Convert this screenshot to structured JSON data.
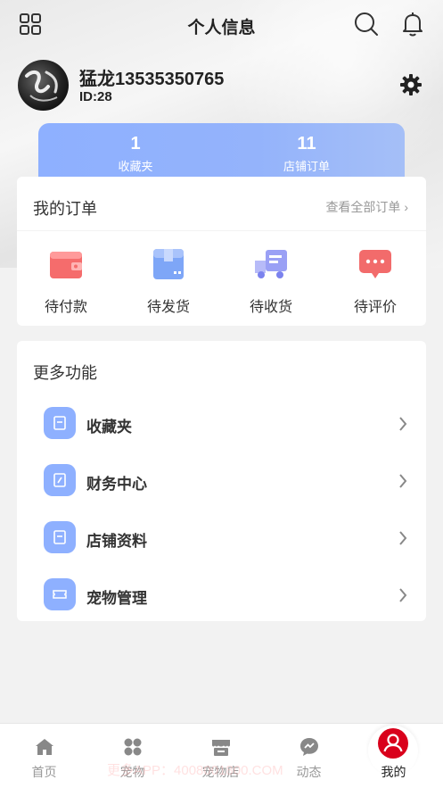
{
  "header": {
    "title": "个人信息"
  },
  "profile": {
    "username": "猛龙13535350765",
    "user_id": "ID:28"
  },
  "stats": [
    {
      "value": "1",
      "label": "收藏夹"
    },
    {
      "value": "11",
      "label": "店铺订单"
    }
  ],
  "orders": {
    "title": "我的订单",
    "view_all": "查看全部订单 ›",
    "items": [
      {
        "label": "待付款",
        "color": "#f56c6c"
      },
      {
        "label": "待发货",
        "color": "#7ea6f7"
      },
      {
        "label": "待收货",
        "color": "#9aa0f5"
      },
      {
        "label": "待评价",
        "color": "#f26b6b"
      }
    ]
  },
  "more": {
    "title": "更多功能",
    "items": [
      {
        "label": "收藏夹"
      },
      {
        "label": "财务中心"
      },
      {
        "label": "店铺资料"
      },
      {
        "label": "宠物管理"
      }
    ]
  },
  "tabbar": {
    "items": [
      {
        "label": "首页"
      },
      {
        "label": "宠物"
      },
      {
        "label": "宠物店"
      },
      {
        "label": "动态"
      },
      {
        "label": "我的"
      }
    ],
    "active_color": "#d9001b"
  },
  "watermark": "更多APP：4008001800.COM",
  "colors": {
    "accent": "#8eb0ff"
  }
}
